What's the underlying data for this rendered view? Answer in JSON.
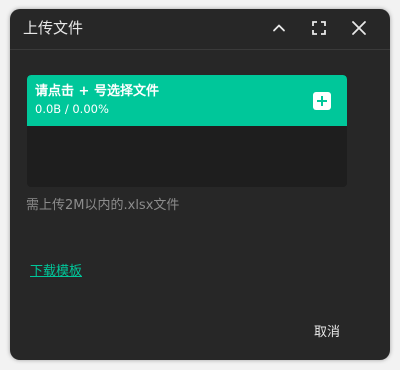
{
  "dialog": {
    "title": "上传文件",
    "upload": {
      "title": "请点击 + 号选择文件",
      "progress": "0.0B / 0.00%"
    },
    "hint": "需上传2M以内的.xlsx文件",
    "template_link": "下载模板",
    "cancel_label": "取消"
  },
  "icons": {
    "collapse": "chevron-up-icon",
    "fullscreen": "fullscreen-icon",
    "close": "close-icon",
    "add": "plus-square-icon"
  },
  "colors": {
    "accent": "#00c79a",
    "dialog_background": "#272727",
    "text": "#e8e8e8",
    "hint_text": "#8c8c8c"
  }
}
